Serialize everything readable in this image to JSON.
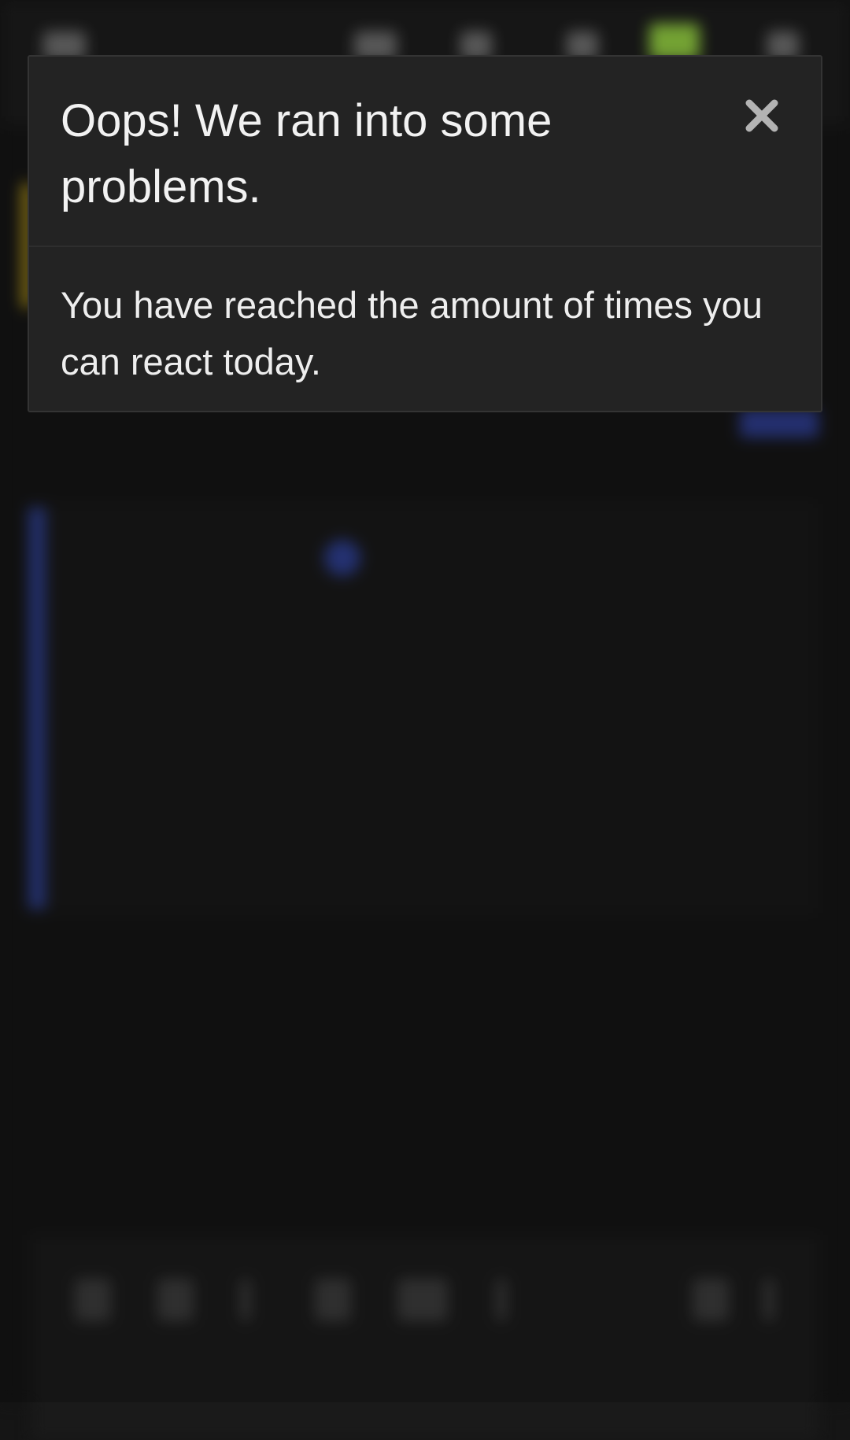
{
  "dialog": {
    "title": "Oops! We ran into some problems.",
    "message": "You have reached the amount of times you can react today.",
    "close_icon": "close-icon"
  }
}
